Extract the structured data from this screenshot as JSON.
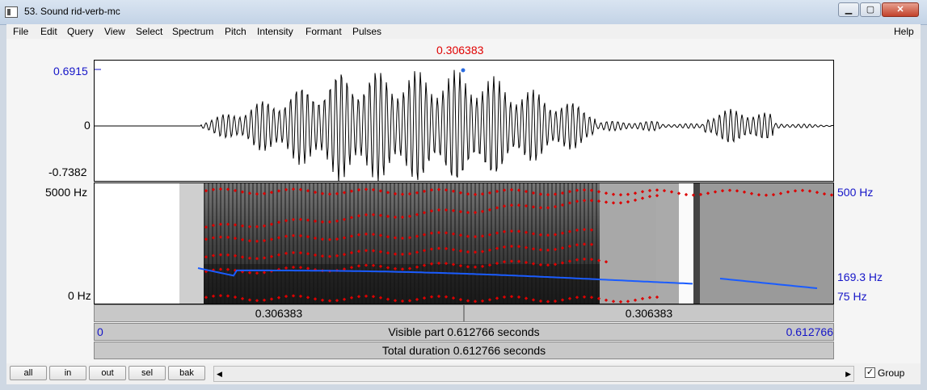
{
  "window": {
    "title": "53. Sound rid-verb-mc",
    "min_label": "▁",
    "max_label": "▢",
    "close_label": "✕"
  },
  "menu": {
    "items": [
      "File",
      "Edit",
      "Query",
      "View",
      "Select",
      "Spectrum",
      "Pitch",
      "Intensity",
      "Formant",
      "Pulses"
    ],
    "help": "Help"
  },
  "cursor": {
    "time": "0.306383"
  },
  "waveform": {
    "max_label": "0.6915",
    "zero_label": "0",
    "min_label": "-0.7382"
  },
  "spectrogram": {
    "top_label": "5000 Hz",
    "bottom_label": "0 Hz",
    "pitch_top": "500 Hz",
    "pitch_value": "169.3 Hz",
    "pitch_bottom": "75 Hz"
  },
  "time_bars": {
    "left_segment": "0.306383",
    "right_segment": "0.306383",
    "start": "0",
    "visible": "Visible part 0.612766 seconds",
    "end": "0.612766",
    "total": "Total duration 0.612766 seconds"
  },
  "buttons": {
    "all": "all",
    "in": "in",
    "out": "out",
    "sel": "sel",
    "bak": "bak"
  },
  "group": {
    "label": "Group",
    "checked": "✓"
  },
  "colors": {
    "pitch": "#1a5cff",
    "formant": "#dd0000",
    "cursor_text": "#e00000",
    "axis_text": "#1515c8"
  }
}
